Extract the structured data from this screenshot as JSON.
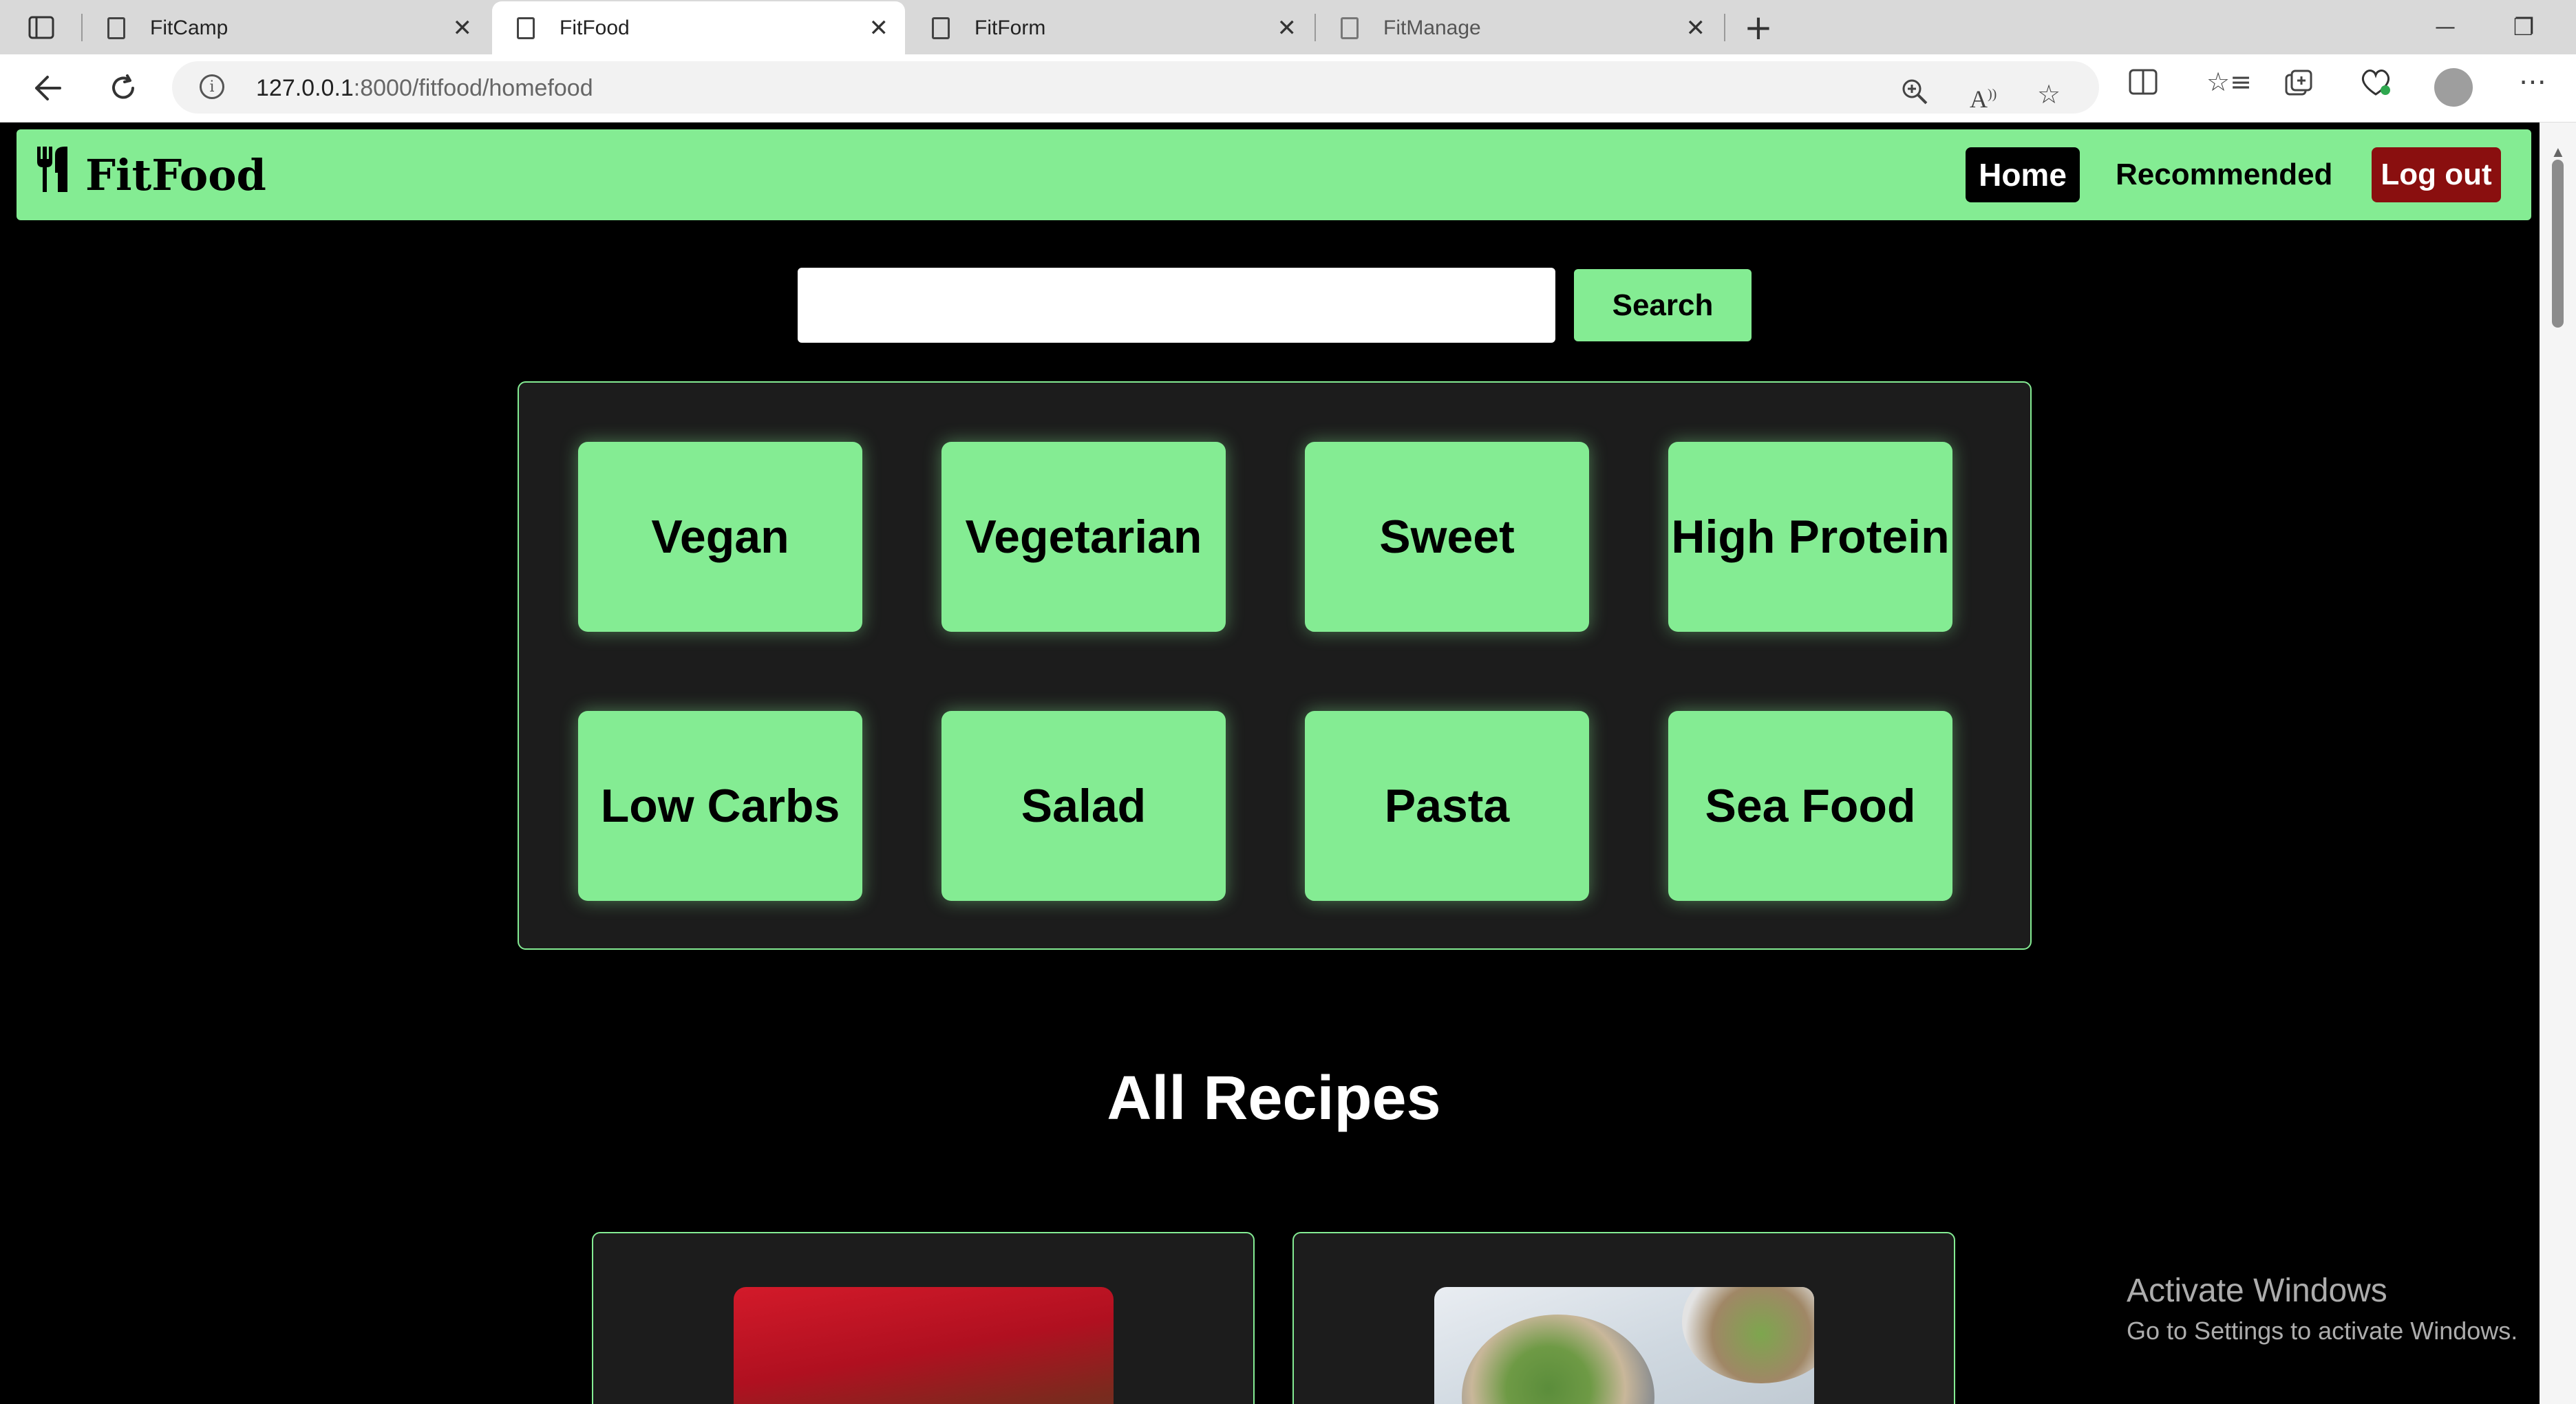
{
  "browser": {
    "tabs": [
      {
        "label": "FitCamp",
        "active": false
      },
      {
        "label": "FitFood",
        "active": true
      },
      {
        "label": "FitForm",
        "active": false
      },
      {
        "label": "FitManage",
        "active": false
      }
    ],
    "url_host": "127.0.0.1",
    "url_path": ":8000/fitfood/homefood",
    "new_tab_label": "+",
    "close_glyph": "✕",
    "minimize_glyph": "—",
    "restore_glyph": "❐"
  },
  "navbar": {
    "brand": "FitFood",
    "brand_icon": "utensils-icon",
    "items": {
      "home": "Home",
      "recommended": "Recommended",
      "logout": "Log out"
    }
  },
  "search": {
    "value": "",
    "placeholder": "",
    "button": "Search"
  },
  "categories": [
    "Vegan",
    "Vegetarian",
    "Sweet",
    "High Protein",
    "Low Carbs",
    "Salad",
    "Pasta",
    "Sea Food"
  ],
  "recipes_section": {
    "title": "All Recipes"
  },
  "watermark": {
    "title": "Activate Windows",
    "subtitle": "Go to Settings to activate Windows."
  },
  "colors": {
    "accent": "#84ec93",
    "logout": "#8a0f0f",
    "panel": "#1c1c1c",
    "background": "#000000"
  }
}
